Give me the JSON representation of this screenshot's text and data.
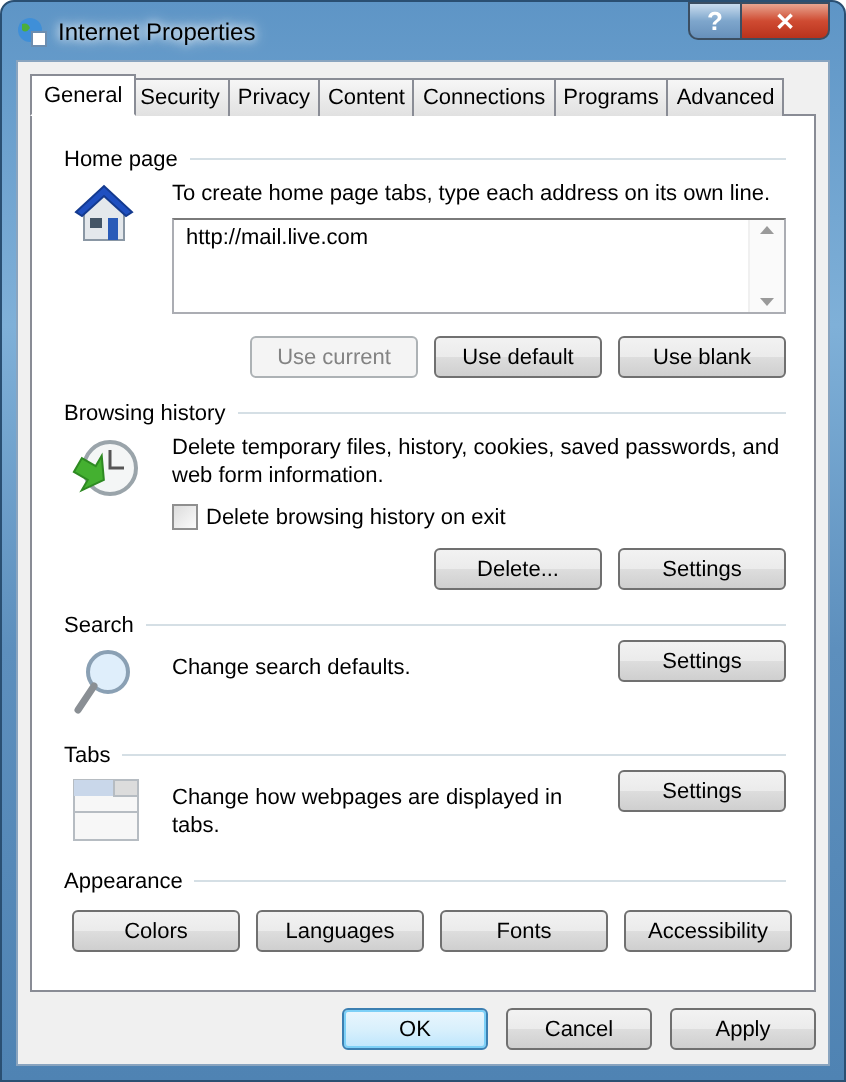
{
  "window": {
    "title": "Internet Properties"
  },
  "title_buttons": [
    {
      "kind": "help",
      "label": "?"
    },
    {
      "kind": "close",
      "label": "✕"
    }
  ],
  "tabs": [
    {
      "label": "General",
      "selected": true
    },
    {
      "label": "Security",
      "selected": false
    },
    {
      "label": "Privacy",
      "selected": false
    },
    {
      "label": "Content",
      "selected": false
    },
    {
      "label": "Connections",
      "selected": false
    },
    {
      "label": "Programs",
      "selected": false
    },
    {
      "label": "Advanced",
      "selected": false
    }
  ],
  "sections": [
    {
      "kind": "home_page",
      "title": "Home page",
      "description": "To create home page tabs, type each address on its own line.",
      "value": "http://mail.live.com",
      "buttons": [
        {
          "label": "Use current",
          "disabled": true
        },
        {
          "label": "Use default",
          "disabled": false
        },
        {
          "label": "Use blank",
          "disabled": false
        }
      ]
    },
    {
      "kind": "browsing_history",
      "title": "Browsing history",
      "description": "Delete temporary files, history, cookies, saved passwords, and web form information.",
      "checkbox": {
        "label": "Delete browsing history on exit",
        "checked": false
      },
      "buttons": [
        {
          "label": "Delete...",
          "disabled": false
        },
        {
          "label": "Settings",
          "disabled": false
        }
      ]
    },
    {
      "kind": "search",
      "title": "Search",
      "description": "Change search defaults.",
      "buttons": [
        {
          "label": "Settings",
          "disabled": false
        }
      ]
    },
    {
      "kind": "tabs",
      "title": "Tabs",
      "description": "Change how webpages are displayed in tabs.",
      "buttons": [
        {
          "label": "Settings",
          "disabled": false
        }
      ]
    },
    {
      "kind": "appearance",
      "title": "Appearance",
      "buttons": [
        {
          "label": "Colors",
          "disabled": false
        },
        {
          "label": "Languages",
          "disabled": false
        },
        {
          "label": "Fonts",
          "disabled": false
        },
        {
          "label": "Accessibility",
          "disabled": false
        }
      ]
    }
  ],
  "footer_buttons": [
    {
      "label": "OK",
      "default": true
    },
    {
      "label": "Cancel",
      "default": false
    },
    {
      "label": "Apply",
      "default": false
    }
  ]
}
